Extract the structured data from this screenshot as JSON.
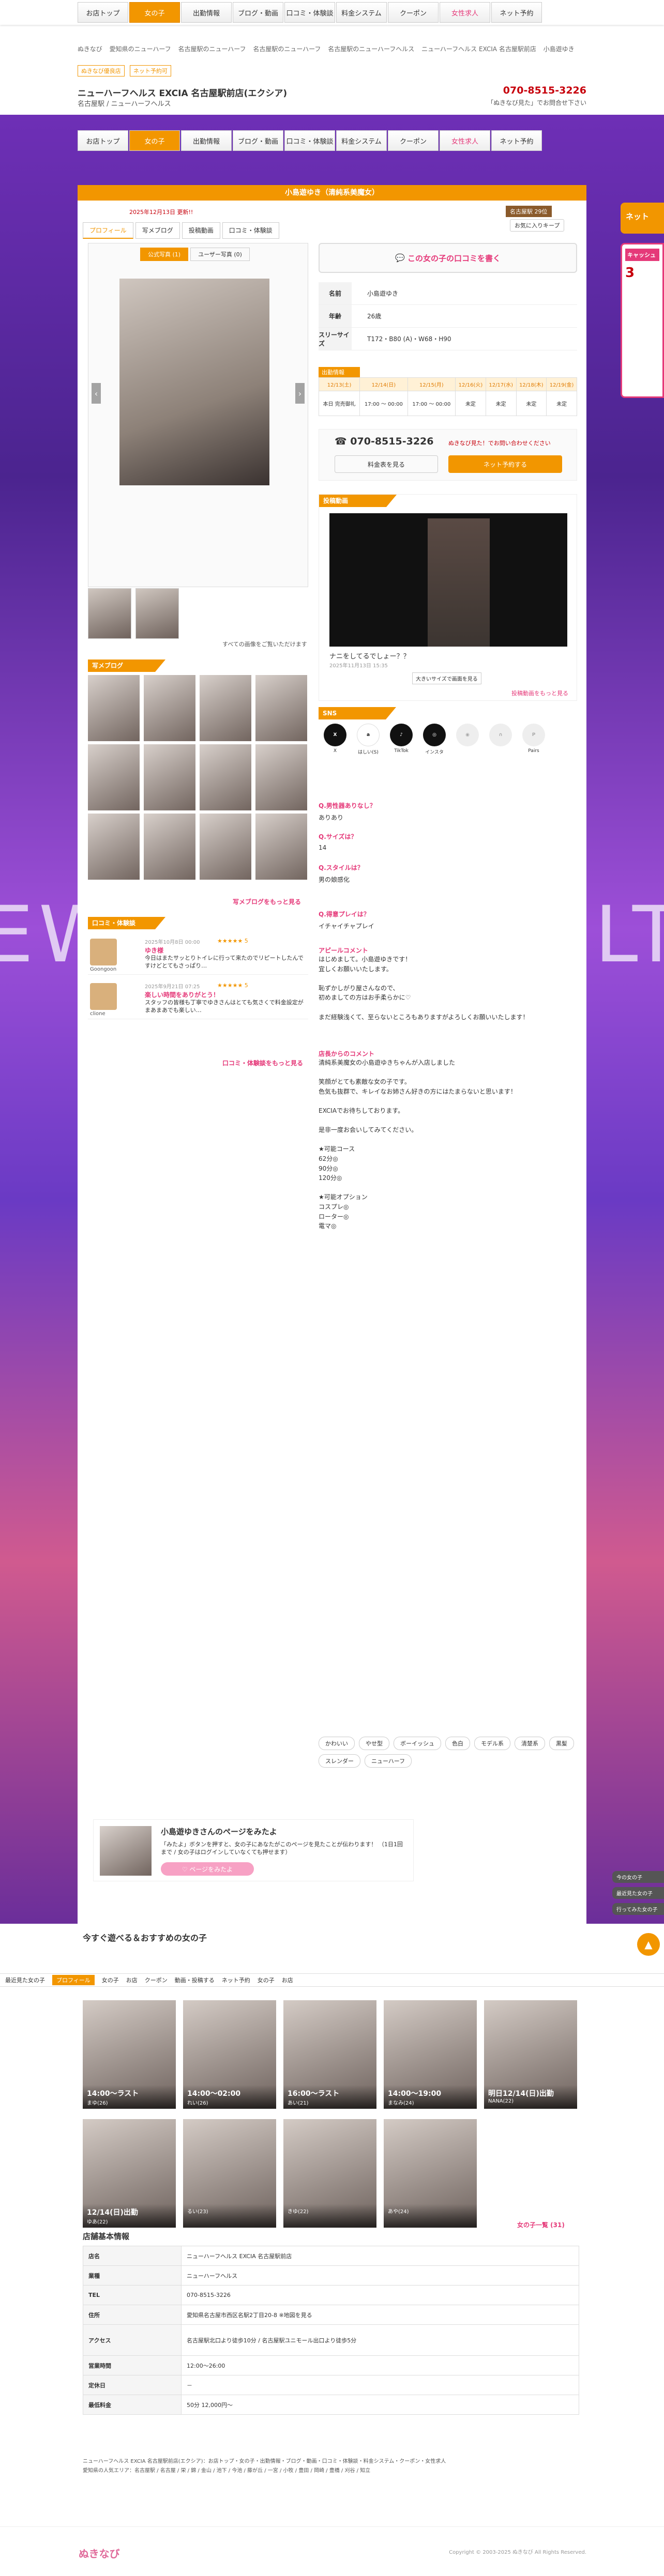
{
  "site": {
    "logo": "ぬきなび"
  },
  "nav": [
    "お店トップ",
    "女の子",
    "出勤情報",
    "ブログ・動画",
    "口コミ・体験談",
    "料金システム",
    "クーポン",
    "女性求人",
    "ネット予約"
  ],
  "breadcrumbs": [
    "ぬきなび",
    "愛知県のニューハーフ",
    "名古屋駅のニューハーフ",
    "名古屋駅のニューハーフ",
    "名古屋駅のニューハーフヘルス",
    "ニューハーフヘルス EXCIA 名古屋駅前店",
    "小島遊ゆき"
  ],
  "shop": {
    "badge1": "ぬきなび優良店",
    "badge2": "ネット予約可",
    "name": "ニューハーフヘルス EXCIA 名古屋駅前店(エクシア)",
    "type": "名古屋駅 / ニューハーフヘルス",
    "tel": "070-8515-3226",
    "telnote": "「ぬきなび見た」でお問合せ下さい"
  },
  "profile": {
    "title": "小島遊ゆき（清純系美魔女）",
    "updated": "2025年12月13日 更新!!",
    "rank": "名古屋駅 29位",
    "fav": "お気に入りキープ",
    "tabs": [
      "プロフィール",
      "写メブログ",
      "投稿動画",
      "口コミ・体験談"
    ],
    "photo_tabs": [
      "公式写真 (1)",
      "ユーザー写真 (0)"
    ],
    "view_link": "すべての画像をご覧いただけます",
    "review_btn": "この女の子の口コミを書く",
    "rows": [
      {
        "k": "名前",
        "v": "小島遊ゆき"
      },
      {
        "k": "年齢",
        "v": "26歳"
      },
      {
        "k": "スリーサイズ",
        "v": "T172・B80 (A)・W68・H90"
      }
    ]
  },
  "schedule": {
    "label": "出勤情報",
    "days": [
      "12/13(土)",
      "12/14(日)",
      "12/15(月)",
      "12/16(火)",
      "12/17(水)",
      "12/18(木)",
      "12/19(金)"
    ],
    "times": [
      "本日 完売御礼",
      "17:00 〜 00:00",
      "17:00 〜 00:00",
      "未定",
      "未定",
      "未定",
      "未定"
    ]
  },
  "call": {
    "tel": "070-8515-3226",
    "note": "ぬきなび見た！でお問い合わせください",
    "btn1": "料金表を見る",
    "btn2": "ネット予約する"
  },
  "video": {
    "label": "投稿動画",
    "caption": "ナニをしてるでしょー？？",
    "date": "2025年11月13日 15:35",
    "full": "大きいサイズで画面を見る",
    "more": "投稿動画をもっと見る"
  },
  "blog": {
    "label": "写メブログ",
    "more": "写メブログをもっと見る"
  },
  "kuchikomi": {
    "label": "口コミ・体験談",
    "more": "口コミ・体験談をもっと見る",
    "items": [
      {
        "name": "Goongoon",
        "date": "2025年10月8日 00:00",
        "stars": "★★★★★ 5",
        "title": "ゆき様",
        "text": "今日はまたサッとりトイレに行って来たのでリピートしたんですけどとてもさっぱり…"
      },
      {
        "name": "clione",
        "date": "2025年9月21日 07:25",
        "stars": "★★★★★ 5",
        "title": "楽しい時間をありがとう！",
        "text": "スタッフの皆様も丁寧でゆきさんはとても気さくで料金設定がまあまあでも楽しい…"
      }
    ]
  },
  "sns": [
    "X",
    "はしい(S)",
    "TikTok",
    "インスタ",
    "",
    "",
    "Pairs"
  ],
  "qa": [
    {
      "q": "Q.男性器ありなし？",
      "a": "ありあり"
    },
    {
      "q": "Q.サイズは？",
      "a": "14"
    },
    {
      "q": "Q.スタイルは？",
      "a": "男の娘感化"
    },
    {
      "q": "Q.得意プレイは？",
      "a": "イチャイチャプレイ"
    }
  ],
  "appeal": {
    "label": "アピールコメント",
    "text": "はじめまして。小島遊ゆきです！\n宜しくお願いいたします。\n\n恥ずかしがり屋さんなので、\n初めましての方はお手柔らかに♡\n\nまだ経験浅くて、至らないところもありますがよろしくお願いいたします！"
  },
  "staff": {
    "label": "店長からのコメント",
    "text": "清純系美魔女の小島遊ゆきちゃんが入店しました\n\n笑顔がとても素敵な女の子です。\n色気も抜群で、キレイなお姉さん好きの方にはたまらないと思います！\n\nEXCIAでお待ちしております。\n\n是非一度お会いしてみてください。\n\n★可能コース\n62分◎\n90分◎\n120分◎\n\n★可能オプション\nコスプレ◎\nローター◎\n電マ◎"
  },
  "tags": [
    "かわいい",
    "やせ型",
    "ボーイッシュ",
    "色白",
    "モデル系",
    "清楚系",
    "黒髪",
    "スレンダー",
    "ニューハーフ"
  ],
  "promo": {
    "title": "小島遊ゆきさんのページをみたよ",
    "desc": "「みたよ」ボタンを押すと、女の子にあなたがこのページを見たことが伝わります！\n（1日1回まで / 女の子はログインしていなくても押せます）",
    "btn": "♡ ページをみたよ"
  },
  "recommend": {
    "title": "今すぐ遊べる＆おすすめの女の子",
    "stickybar": [
      "最近見た女の子",
      "プロフィール",
      "女の子",
      "お店",
      "クーポン",
      "動画・投稿する",
      "ネット予約",
      "女の子",
      "お店"
    ],
    "cards": [
      {
        "s": "14:00〜ラスト",
        "n": "まゆ(26)"
      },
      {
        "s": "14:00〜02:00",
        "n": "れい(26)"
      },
      {
        "s": "16:00〜ラスト",
        "n": "あい(21)"
      },
      {
        "s": "14:00〜19:00",
        "n": "まなみ(24)"
      },
      {
        "s": "明日12/14(日)出勤",
        "n": "NANA(22)"
      },
      {
        "s": "12/14(日)出勤",
        "n": "ゆあ(22)"
      },
      {
        "s": "",
        "n": "るい(23)"
      },
      {
        "s": "",
        "n": "きゆ(22)"
      },
      {
        "s": "",
        "n": "あや(24)"
      }
    ],
    "more": "女の子一覧 (31)"
  },
  "shopinfo": {
    "title": "店舗基本情報",
    "rows": [
      {
        "k": "店名",
        "v": "ニューハーフヘルス EXCIA 名古屋駅前店"
      },
      {
        "k": "業種",
        "v": "ニューハーフヘルス"
      },
      {
        "k": "TEL",
        "v": "070-8515-3226"
      },
      {
        "k": "住所",
        "v": "愛知県名古屋市西区名駅2丁目20-8 ※地図を見る"
      },
      {
        "k": "アクセス",
        "v": "名古屋駅北口より徒歩10分 / 名古屋駅ユニモール出口より徒歩5分"
      },
      {
        "k": "営業時間",
        "v": "12:00〜26:00"
      },
      {
        "k": "定休日",
        "v": "－"
      },
      {
        "k": "最低料金",
        "v": "50分 12,000円〜"
      }
    ]
  },
  "footer": {
    "links": "ニューハーフヘルス EXCIA 名古屋駅前店(エクシア)：お店トップ・女の子・出勤情報・ブログ・動画・口コミ・体験談・料金システム・クーポン・女性求人",
    "area": "愛知県の人気エリア：名古屋駅 / 名古屋 / 栄 / 錦 / 金山 / 池下 / 今池 / 藤が丘 / 一宮 / 小牧 / 豊田 / 岡崎 / 豊橋 / 刈谷 / 知立",
    "copy": "Copyright © 2003-2025 ぬきなび All Rights Reserved."
  },
  "side": {
    "tab1": "ネット",
    "tab2_title": "キャッシュ",
    "tab2_main": "3",
    "btns": [
      "今の女の子",
      "最近見た女の子",
      "行ってみた女の子"
    ],
    "top": "▲"
  }
}
